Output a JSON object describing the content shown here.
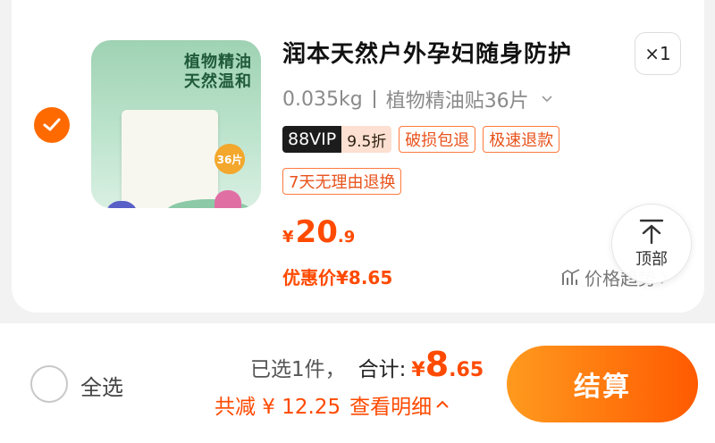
{
  "item": {
    "selected": true,
    "title": "润本天然户外孕妇随身防护",
    "quantity": "×1",
    "image_text": "植物精油\n天然温和",
    "image_badge": "36片",
    "spec_weight": "0.035kg",
    "spec_variant": "植物精油贴36片",
    "vip_label": "88VIP",
    "vip_discount": "9.5折",
    "service_tags": [
      "破损包退",
      "极速退款",
      "7天无理由退换"
    ],
    "price_yen": "¥",
    "price_int": "20",
    "price_dec": ".9",
    "promo_price": "优惠价¥8.65",
    "price_trend": "价格趋势"
  },
  "back_to_top": {
    "label": "顶部"
  },
  "footer": {
    "select_all": "全选",
    "selected_count": "已选1件，",
    "total_label": "合计:",
    "total_yen": "¥",
    "total_int": "8",
    "total_dec": ".65",
    "discount_text": "共减 ¥ 12.25",
    "view_detail": "查看明细",
    "checkout": "结算"
  },
  "colors": {
    "accent": "#ff4a00",
    "checkbox": "#ff6a00",
    "checkout_start": "#ff9a1e",
    "checkout_end": "#ff5a00"
  }
}
